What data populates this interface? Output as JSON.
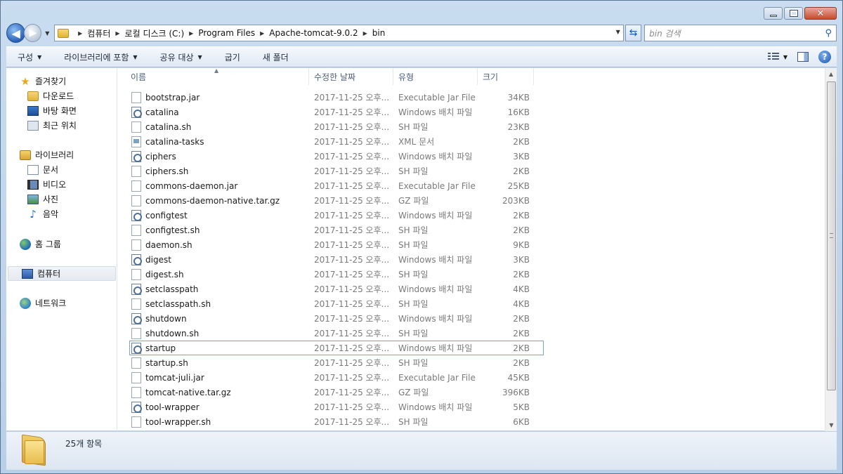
{
  "window": {
    "caption": {
      "minimize": "",
      "maximize": "",
      "close": "✕"
    }
  },
  "nav": {
    "back_icon": "arrow-left",
    "forward_icon": "arrow-right",
    "breadcrumb": [
      "컴퓨터",
      "로컬 디스크 (C:)",
      "Program Files",
      "Apache-tomcat-9.0.2",
      "bin"
    ],
    "search_placeholder": "bin 검색"
  },
  "toolbar": {
    "organize": "구성",
    "include_library": "라이브러리에 포함",
    "share_with": "공유 대상",
    "burn": "굽기",
    "new_folder": "새 폴더"
  },
  "sidebar": {
    "favorites": {
      "label": "즐겨찾기",
      "items": [
        "다운로드",
        "바탕 화면",
        "최근 위치"
      ]
    },
    "libraries": {
      "label": "라이브러리",
      "items": [
        "문서",
        "비디오",
        "사진",
        "음악"
      ]
    },
    "homegroup": "홈 그룹",
    "computer": "컴퓨터",
    "network": "네트워크"
  },
  "columns": {
    "name": "이름",
    "date": "수정한 날짜",
    "type": "유형",
    "size": "크기"
  },
  "files": [
    {
      "name": "bootstrap.jar",
      "date": "2017-11-25 오후...",
      "type": "Executable Jar File",
      "size": "34KB",
      "icon": "plain"
    },
    {
      "name": "catalina",
      "date": "2017-11-25 오후...",
      "type": "Windows 배치 파일",
      "size": "16KB",
      "icon": "batch"
    },
    {
      "name": "catalina.sh",
      "date": "2017-11-25 오후...",
      "type": "SH 파일",
      "size": "23KB",
      "icon": "plain"
    },
    {
      "name": "catalina-tasks",
      "date": "2017-11-25 오후...",
      "type": "XML 문서",
      "size": "2KB",
      "icon": "xml"
    },
    {
      "name": "ciphers",
      "date": "2017-11-25 오후...",
      "type": "Windows 배치 파일",
      "size": "3KB",
      "icon": "batch"
    },
    {
      "name": "ciphers.sh",
      "date": "2017-11-25 오후...",
      "type": "SH 파일",
      "size": "2KB",
      "icon": "plain"
    },
    {
      "name": "commons-daemon.jar",
      "date": "2017-11-25 오후...",
      "type": "Executable Jar File",
      "size": "25KB",
      "icon": "plain"
    },
    {
      "name": "commons-daemon-native.tar.gz",
      "date": "2017-11-25 오후...",
      "type": "GZ 파일",
      "size": "203KB",
      "icon": "plain"
    },
    {
      "name": "configtest",
      "date": "2017-11-25 오후...",
      "type": "Windows 배치 파일",
      "size": "2KB",
      "icon": "batch"
    },
    {
      "name": "configtest.sh",
      "date": "2017-11-25 오후...",
      "type": "SH 파일",
      "size": "2KB",
      "icon": "plain"
    },
    {
      "name": "daemon.sh",
      "date": "2017-11-25 오후...",
      "type": "SH 파일",
      "size": "9KB",
      "icon": "plain"
    },
    {
      "name": "digest",
      "date": "2017-11-25 오후...",
      "type": "Windows 배치 파일",
      "size": "3KB",
      "icon": "batch"
    },
    {
      "name": "digest.sh",
      "date": "2017-11-25 오후...",
      "type": "SH 파일",
      "size": "2KB",
      "icon": "plain"
    },
    {
      "name": "setclasspath",
      "date": "2017-11-25 오후...",
      "type": "Windows 배치 파일",
      "size": "4KB",
      "icon": "batch"
    },
    {
      "name": "setclasspath.sh",
      "date": "2017-11-25 오후...",
      "type": "SH 파일",
      "size": "4KB",
      "icon": "plain"
    },
    {
      "name": "shutdown",
      "date": "2017-11-25 오후...",
      "type": "Windows 배치 파일",
      "size": "2KB",
      "icon": "batch"
    },
    {
      "name": "shutdown.sh",
      "date": "2017-11-25 오후...",
      "type": "SH 파일",
      "size": "2KB",
      "icon": "plain"
    },
    {
      "name": "startup",
      "date": "2017-11-25 오후...",
      "type": "Windows 배치 파일",
      "size": "2KB",
      "icon": "batch",
      "focused": true
    },
    {
      "name": "startup.sh",
      "date": "2017-11-25 오후...",
      "type": "SH 파일",
      "size": "2KB",
      "icon": "plain"
    },
    {
      "name": "tomcat-juli.jar",
      "date": "2017-11-25 오후...",
      "type": "Executable Jar File",
      "size": "45KB",
      "icon": "plain"
    },
    {
      "name": "tomcat-native.tar.gz",
      "date": "2017-11-25 오후...",
      "type": "GZ 파일",
      "size": "396KB",
      "icon": "plain"
    },
    {
      "name": "tool-wrapper",
      "date": "2017-11-25 오후...",
      "type": "Windows 배치 파일",
      "size": "5KB",
      "icon": "batch"
    },
    {
      "name": "tool-wrapper.sh",
      "date": "2017-11-25 오후...",
      "type": "SH 파일",
      "size": "6KB",
      "icon": "plain"
    }
  ],
  "status": {
    "item_count": "25개 항목"
  }
}
